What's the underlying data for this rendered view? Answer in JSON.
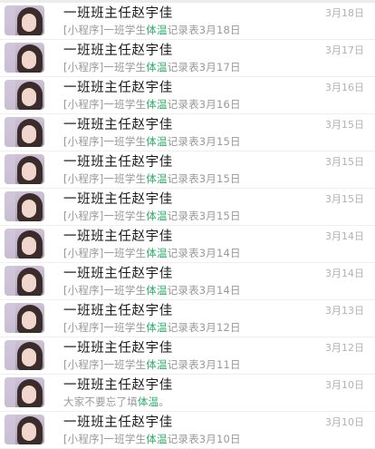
{
  "colors": {
    "highlight": "#2aae67",
    "time": "#b2b2b2",
    "preview": "#999999"
  },
  "conversations": [
    {
      "sender": "一班班主任赵宇佳",
      "time": "3月18日",
      "pre": "[小程序]一班学生",
      "hl": "体温",
      "post": "记录表3月18日"
    },
    {
      "sender": "一班班主任赵宇佳",
      "time": "3月17日",
      "pre": "[小程序]一班学生",
      "hl": "体温",
      "post": "记录表3月17日"
    },
    {
      "sender": "一班班主任赵宇佳",
      "time": "3月16日",
      "pre": "[小程序]一班学生",
      "hl": "体温",
      "post": "记录表3月16日"
    },
    {
      "sender": "一班班主任赵宇佳",
      "time": "3月15日",
      "pre": "[小程序]一班学生",
      "hl": "体温",
      "post": "记录表3月15日"
    },
    {
      "sender": "一班班主任赵宇佳",
      "time": "3月15日",
      "pre": "[小程序]一班学生",
      "hl": "体温",
      "post": "记录表3月15日"
    },
    {
      "sender": "一班班主任赵宇佳",
      "time": "3月15日",
      "pre": "[小程序]一班学生",
      "hl": "体温",
      "post": "记录表3月15日"
    },
    {
      "sender": "一班班主任赵宇佳",
      "time": "3月14日",
      "pre": "[小程序]一班学生",
      "hl": "体温",
      "post": "记录表3月14日"
    },
    {
      "sender": "一班班主任赵宇佳",
      "time": "3月14日",
      "pre": "[小程序]一班学生",
      "hl": "体温",
      "post": "记录表3月14日"
    },
    {
      "sender": "一班班主任赵宇佳",
      "time": "3月13日",
      "pre": "[小程序]一班学生",
      "hl": "体温",
      "post": "记录表3月12日"
    },
    {
      "sender": "一班班主任赵宇佳",
      "time": "3月12日",
      "pre": "[小程序]一班学生",
      "hl": "体温",
      "post": "记录表3月11日"
    },
    {
      "sender": "一班班主任赵宇佳",
      "time": "3月10日",
      "pre": "大家不要忘了填",
      "hl": "体温",
      "post": "。"
    },
    {
      "sender": "一班班主任赵宇佳",
      "time": "3月10日",
      "pre": "[小程序]一班学生",
      "hl": "体温",
      "post": "记录表3月10日"
    }
  ]
}
